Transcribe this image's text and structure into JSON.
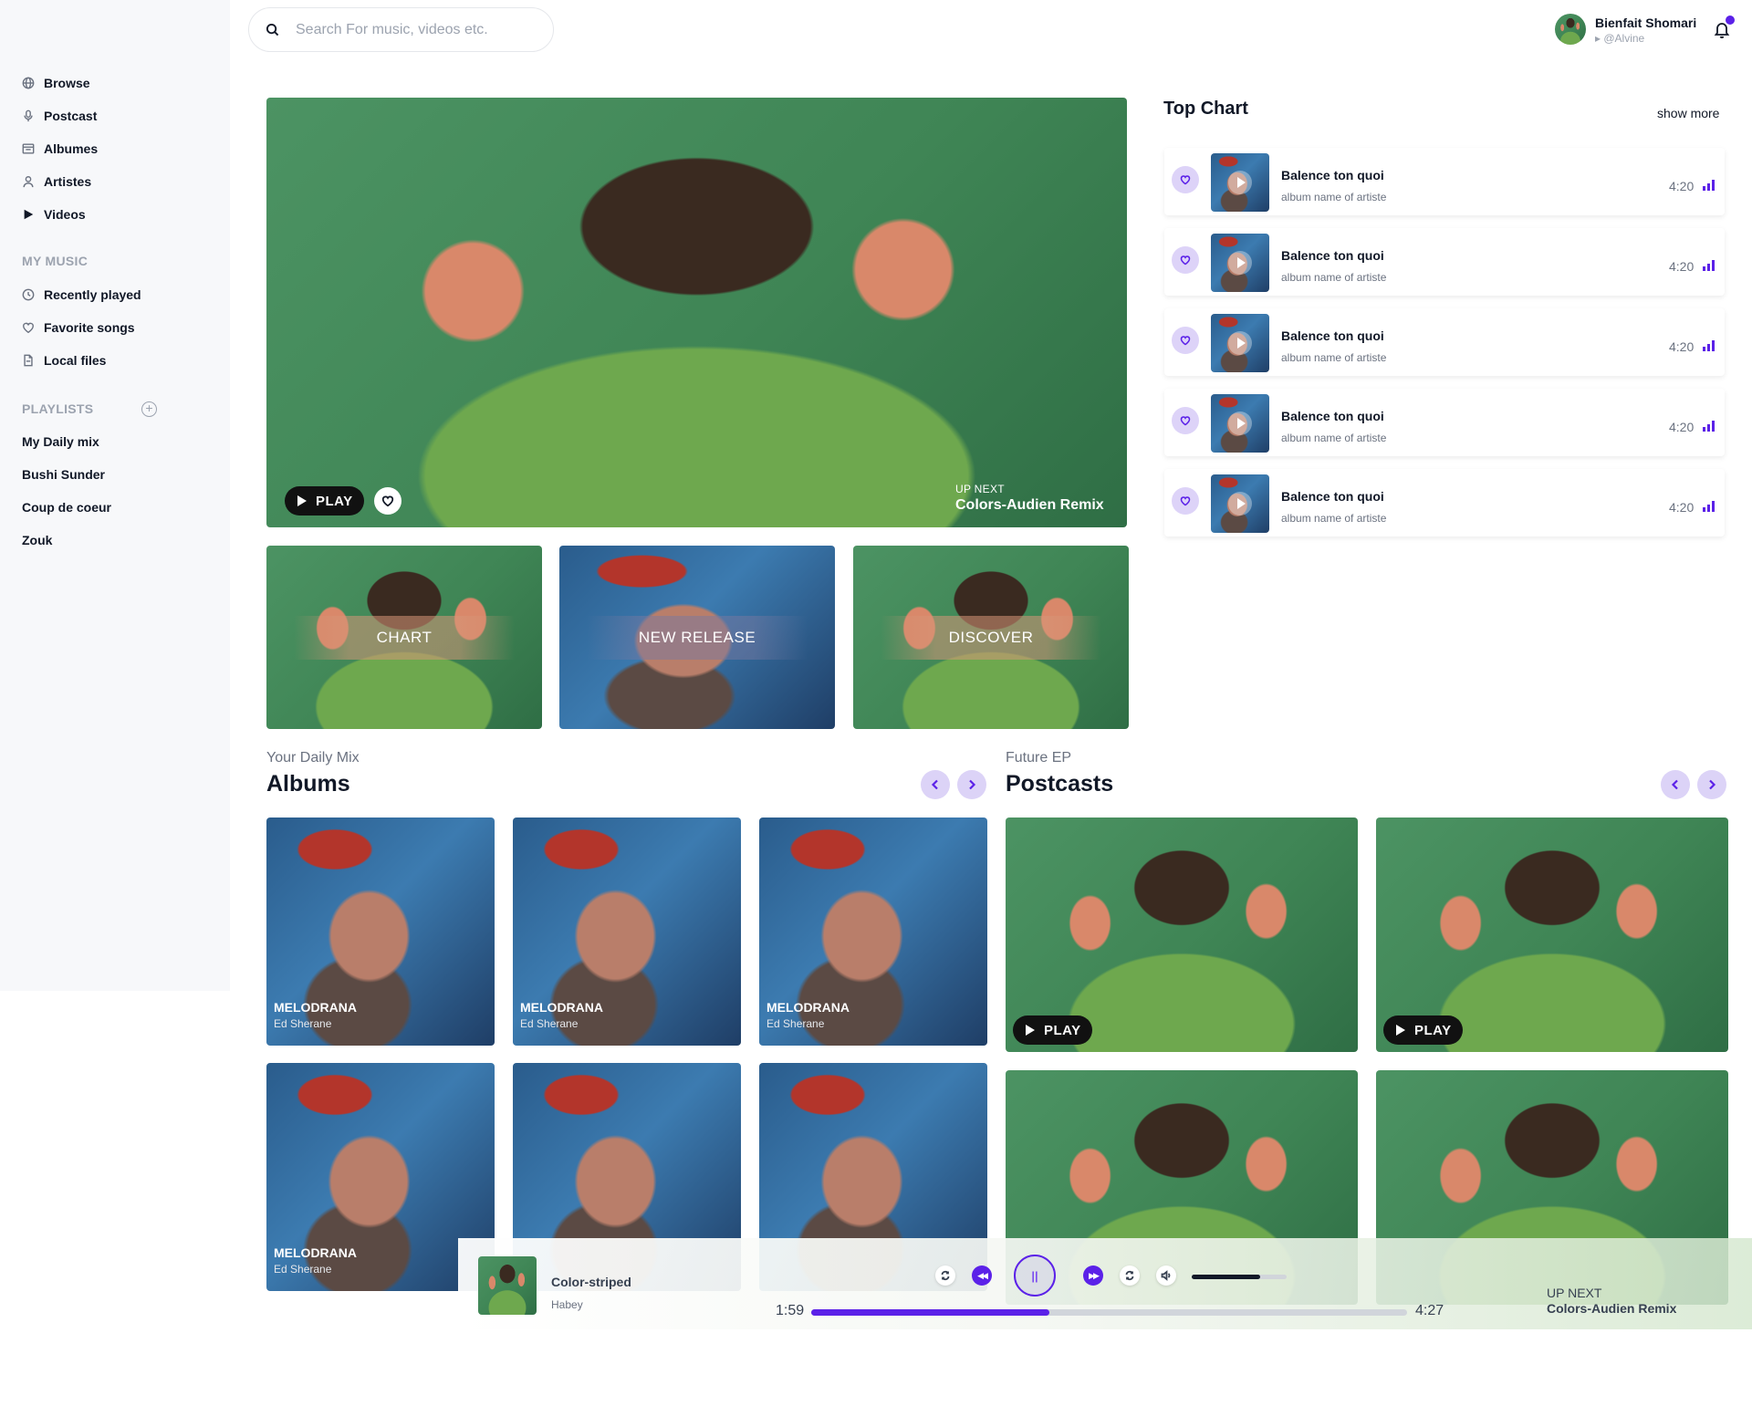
{
  "search": {
    "placeholder": "Search For music, videos etc."
  },
  "user": {
    "name": "Bienfait Shomari",
    "handle": "▸ @Alvine"
  },
  "sidebar": {
    "nav": [
      {
        "label": "Browse",
        "icon": "globe-icon"
      },
      {
        "label": "Postcast",
        "icon": "mic-icon"
      },
      {
        "label": "Albumes",
        "icon": "album-icon"
      },
      {
        "label": "Artistes",
        "icon": "user-icon"
      },
      {
        "label": "Videos",
        "icon": "play-icon"
      }
    ],
    "my_music_heading": "MY MUSIC",
    "my_music": [
      {
        "label": "Recently played",
        "icon": "clock-icon"
      },
      {
        "label": "Favorite songs",
        "icon": "heart-icon"
      },
      {
        "label": "Local files",
        "icon": "file-icon"
      }
    ],
    "playlists_heading": "PLAYLISTS",
    "playlists": [
      "My Daily mix",
      "Bushi Sunder",
      "Coup de coeur",
      "Zouk"
    ]
  },
  "hero": {
    "play_label": "PLAY",
    "up_next_label": "UP NEXT",
    "up_next_title": "Colors-Audien Remix"
  },
  "tiles": [
    {
      "label": "CHART"
    },
    {
      "label": "NEW RELEASE"
    },
    {
      "label": "DISCOVER"
    }
  ],
  "albums_section": {
    "subtitle": "Your Daily Mix",
    "title": "Albums",
    "items": [
      {
        "title": "MELODRANA",
        "artist": "Ed Sherane"
      },
      {
        "title": "MELODRANA",
        "artist": "Ed Sherane"
      },
      {
        "title": "MELODRANA",
        "artist": "Ed Sherane"
      },
      {
        "title": "MELODRANA",
        "artist": "Ed Sherane"
      }
    ]
  },
  "podcasts_section": {
    "subtitle": "Future EP",
    "title": "Postcasts",
    "play_label": "PLAY"
  },
  "top_chart": {
    "title": "Top Chart",
    "show_more": "show more",
    "rows": [
      {
        "song": "Balence ton quoi",
        "album": "album name of artiste",
        "duration": "4:20"
      },
      {
        "song": "Balence ton quoi",
        "album": "album name of artiste",
        "duration": "4:20"
      },
      {
        "song": "Balence ton quoi",
        "album": "album name of artiste",
        "duration": "4:20"
      },
      {
        "song": "Balence ton quoi",
        "album": "album name of artiste",
        "duration": "4:20"
      },
      {
        "song": "Balence ton quoi",
        "album": "album name of artiste",
        "duration": "4:20"
      }
    ]
  },
  "player": {
    "song": "Color-striped",
    "artist": "Habey",
    "current_time": "1:59",
    "total_time": "4:27",
    "progress": 0.4,
    "volume": 0.72,
    "up_next_label": "UP NEXT",
    "up_next_title": "Colors-Audien Remix"
  },
  "colors": {
    "accent": "#5b21e8",
    "accent_light": "#ddd3f8",
    "sidebar_bg": "#f7f8fa"
  }
}
